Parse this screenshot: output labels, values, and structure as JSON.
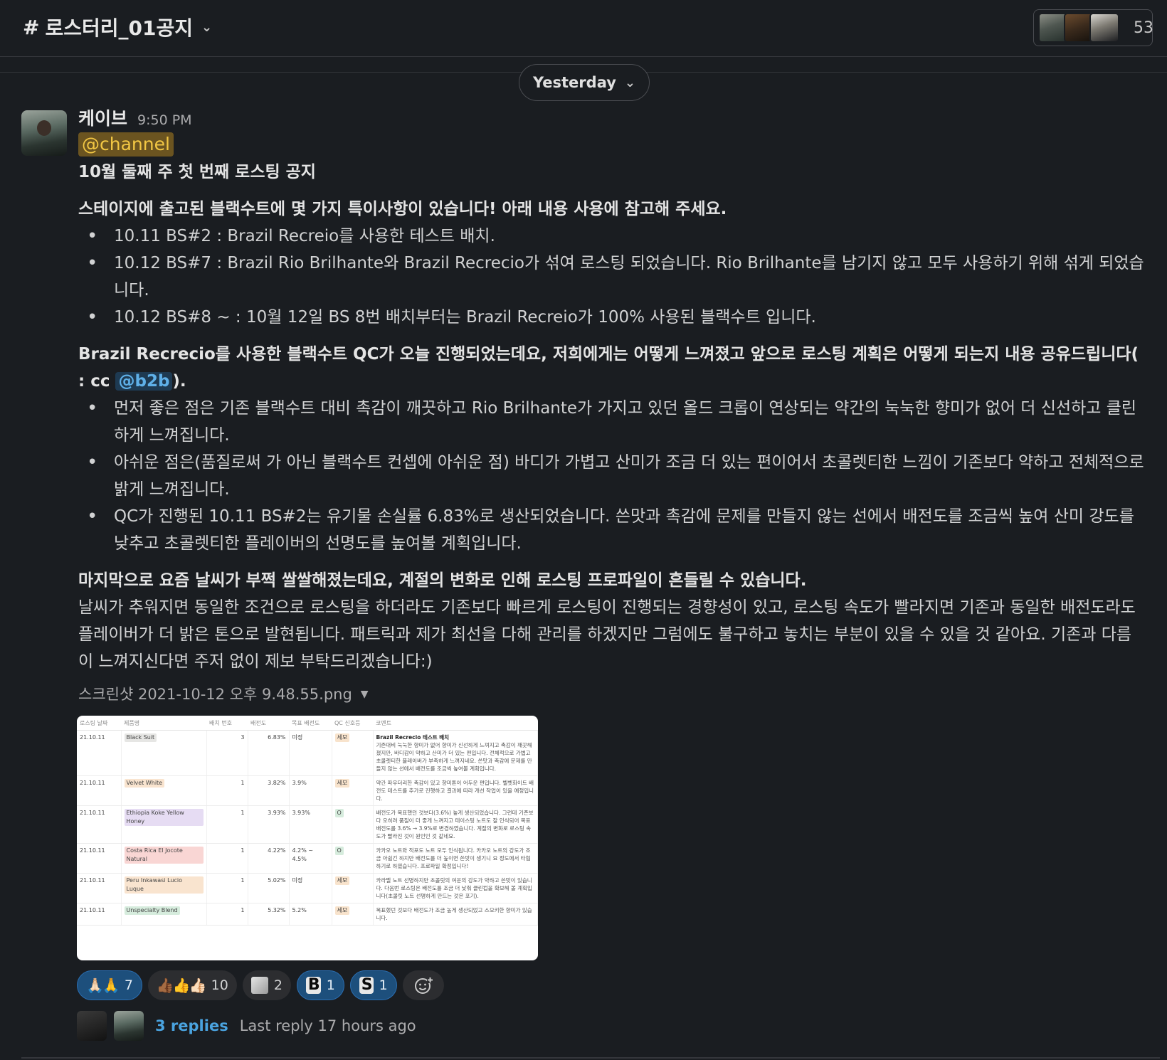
{
  "header": {
    "channel_hash": "#",
    "channel_name": "로스터리_01공지",
    "member_count": "53"
  },
  "date_divider": {
    "label": "Yesterday"
  },
  "message": {
    "author": "케이브",
    "time": "9:50 PM",
    "mention": "@channel",
    "title": "10월 둘째 주 첫 번째 로스팅 공지",
    "section1": {
      "heading": "스테이지에 출고된 블랙수트에 몇 가지 특이사항이 있습니다! 아래 내용 사용에 참고해 주세요.",
      "items": [
        "10.11 BS#2 : Brazil Recreio를 사용한 테스트 배치.",
        "10.12 BS#7 : Brazil Rio Brilhante와 Brazil Recrecio가 섞여 로스팅 되었습니다. Rio Brilhante를 남기지 않고 모두 사용하기 위해 섞게 되었습니다.",
        "10.12 BS#8 ~ : 10월 12일 BS 8번 배치부터는 Brazil Recreio가 100% 사용된 블랙수트 입니다."
      ]
    },
    "section2": {
      "heading_before": "Brazil Recrecio를 사용한 블랙수트 QC가 오늘 진행되었는데요, 저희에게는 어떻게 느껴졌고 앞으로 로스팅 계획은 어떻게 되는지 내용 공유드립니다( : cc ",
      "heading_mention": "@b2b",
      "heading_after": ").",
      "items": [
        "먼저 좋은 점은 기존 블랙수트 대비 촉감이 깨끗하고 Rio Brilhante가 가지고 있던 올드 크롭이 연상되는 약간의 눅눅한 향미가 없어 더 신선하고 클린 하게 느껴집니다.",
        "아쉬운 점은(품질로써 가 아닌 블랙수트 컨셉에 아쉬운 점) 바디가 가볍고 산미가 조금 더 있는 편이어서 초콜렛티한 느낌이 기존보다 약하고 전체적으로 밝게 느껴집니다.",
        "QC가 진행된 10.11 BS#2는 유기물 손실률 6.83%로 생산되었습니다. 쓴맛과 촉감에 문제를 만들지 않는 선에서 배전도를 조금씩 높여 산미 강도를 낮추고 초콜렛티한 플레이버의 선명도를 높여볼 계획입니다."
      ]
    },
    "section3": {
      "heading": "마지막으로 요즘 날씨가 부쩍 쌀쌀해졌는데요, 계절의 변화로 인해 로스팅 프로파일이 흔들릴 수 있습니다.",
      "body": "날씨가 추워지면 동일한 조건으로 로스팅을 하더라도 기존보다 빠르게 로스팅이 진행되는 경향성이 있고, 로스팅 속도가 빨라지면 기존과 동일한 배전도라도 플레이버가 더 밝은 톤으로 발현됩니다. 패트릭과 제가 최선을 다해 관리를 하겠지만 그럼에도 불구하고 놓치는 부분이 있을 수 있을 것 같아요. 기존과 다름이 느껴지신다면 주저 없이 제보 부탁드리겠습니다:)"
    },
    "attachment": {
      "file_name": "스크린샷 2021-10-12 오후 9.48.55.png",
      "table": {
        "headers": [
          "로스팅 날짜",
          "제품명",
          "배치 번호",
          "배전도",
          "목표 배전도",
          "QC 신호등",
          "코멘트"
        ],
        "rows": [
          {
            "date": "21.10.11",
            "product": "Black Suit",
            "tag": "gray",
            "batch": "3",
            "roast": "6.83%",
            "target": "미정",
            "qc": "세모",
            "qc_tag": "orange",
            "comment_title": "Brazil Recrecio 테스트 배치",
            "comment": "기존대비 눅눅한 향미가 없어 향미가 신선하게 느껴지고 촉감이 깨끗해 졌지만, 바디감이 약하고 산미가 더 있는 편입니다. 전체적으로 가볍고 초콜렛티한 플레이버가 부족하게 느껴지네요. 쓴맛과 촉감에 문제를 만들지 않는 선에서 배전도를 조금씩 높여볼 계획입니다."
          },
          {
            "date": "21.10.11",
            "product": "Velvet White",
            "tag": "peach",
            "batch": "1",
            "roast": "3.82%",
            "target": "3.9%",
            "qc": "세모",
            "qc_tag": "orange",
            "comment_title": "",
            "comment": "약간 파우더리한 촉감이 있고 향미톤이 어두운 편입니다. 벨벳화이트 배전도 테스트를 추가로 진행하고 결과에 따라 개선 작업이 있을 예정입니다."
          },
          {
            "date": "21.10.11",
            "product": "Ethiopia Koke Yellow Honey",
            "tag": "purple",
            "batch": "1",
            "roast": "3.93%",
            "target": "3.93%",
            "qc": "O",
            "qc_tag": "green",
            "comment_title": "",
            "comment": "배전도가 목표했던 것보다(3.6%) 높게 생산되었습니다. 그런데 기존보다 오히려 품질이 더 좋게 느껴지고 테이스팅 노트도 잘 인식되어 목표 배전도를 3.6% → 3.9%로 변경하였습니다. 계절의 변화로 로스팅 속도가 빨라진 것이 원인인 것 같네요."
          },
          {
            "date": "21.10.11",
            "product": "Costa Rica El Jocote Natural",
            "tag": "red",
            "batch": "1",
            "roast": "4.22%",
            "target": "4.2% ~ 4.5%",
            "qc": "O",
            "qc_tag": "green",
            "comment_title": "",
            "comment": "카카오 노트와 적포도 노트 모두 인식됩니다. 카카오 노트의 강도가 조금 아쉽긴 하지만 배전도를 더 높이면 쓴맛이 생기니 요 정도에서 타협하기로 하였습니다. 프로파일 확정입니다!"
          },
          {
            "date": "21.10.11",
            "product": "Peru Inkawasi Lucio Luque",
            "tag": "peach",
            "batch": "1",
            "roast": "5.02%",
            "target": "미정",
            "qc": "세모",
            "qc_tag": "orange",
            "comment_title": "",
            "comment": "카라멜 노트 선명하지만 초콜릿의 여운의 강도가 약하고 쓴맛이 있습니다. 다음번 로스팅은 배전도를 조금 더 낮춰 클린컵을 확보해 볼 계획입니다(초콜릿 노트 선명하게 만드는 것은 포기)."
          },
          {
            "date": "21.10.11",
            "product": "Unspecialty Blend",
            "tag": "green",
            "batch": "1",
            "roast": "5.32%",
            "target": "5.2%",
            "qc": "세모",
            "qc_tag": "orange",
            "comment_title": "",
            "comment": "목표했던 것보다 배전도가 조금 높게 생산되었고 스모키한 향미가 있습니다."
          }
        ]
      }
    },
    "reactions": [
      {
        "emoji": "🙏🏻🙏",
        "count": "7",
        "selected": true
      },
      {
        "emoji": "👍🏾👍👍🏻",
        "count": "10",
        "selected": false
      },
      {
        "emoji": "custom-image",
        "count": "2",
        "selected": false
      },
      {
        "emoji": "B",
        "count": "1",
        "selected": true
      },
      {
        "emoji": "S",
        "count": "1",
        "selected": true
      }
    ],
    "thread": {
      "replies": "3 replies",
      "last_reply": "Last reply 17 hours ago"
    }
  }
}
